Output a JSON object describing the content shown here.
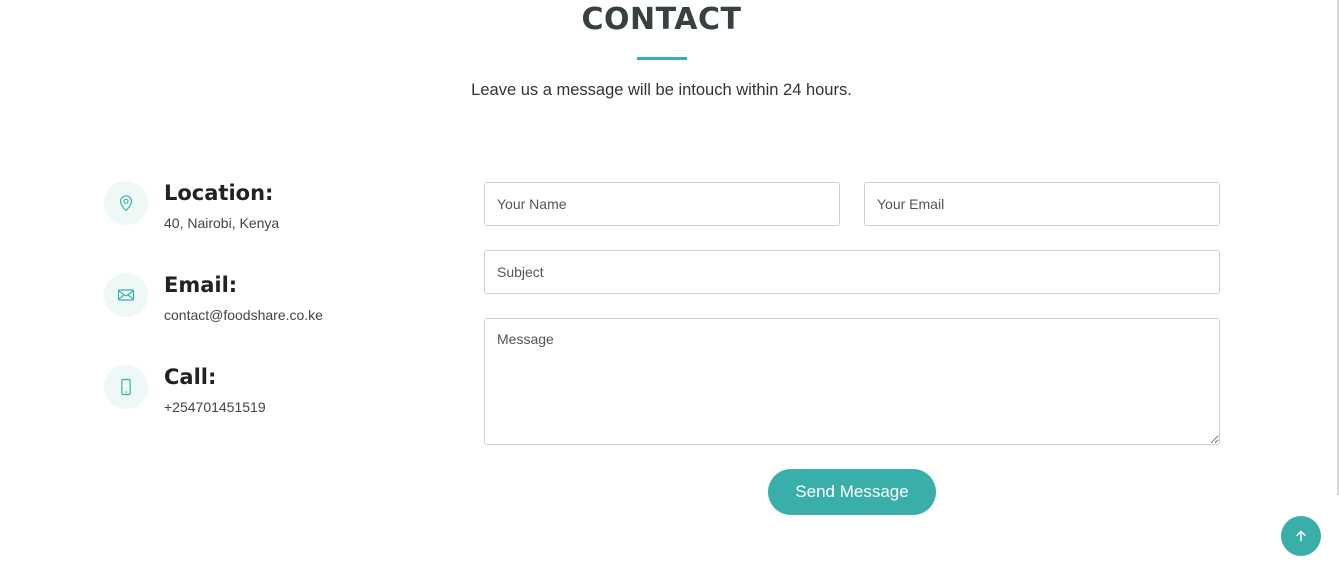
{
  "section": {
    "title": "CONTACT",
    "subtitle": "Leave us a message will be intouch within 24 hours."
  },
  "info": [
    {
      "icon": "map-pin-icon",
      "heading": "Location:",
      "text": "40, Nairobi, Kenya"
    },
    {
      "icon": "envelope-icon",
      "heading": "Email:",
      "text": "contact@foodshare.co.ke"
    },
    {
      "icon": "phone-icon",
      "heading": "Call:",
      "text": "+254701451519"
    }
  ],
  "form": {
    "name_placeholder": "Your Name",
    "email_placeholder": "Your Email",
    "subject_placeholder": "Subject",
    "message_placeholder": "Message",
    "submit_label": "Send Message"
  },
  "back_to_top": {
    "icon": "arrow-up-icon"
  },
  "colors": {
    "accent": "#3aafa9",
    "icon_bg": "#eef8f7",
    "heading": "#37423b"
  }
}
